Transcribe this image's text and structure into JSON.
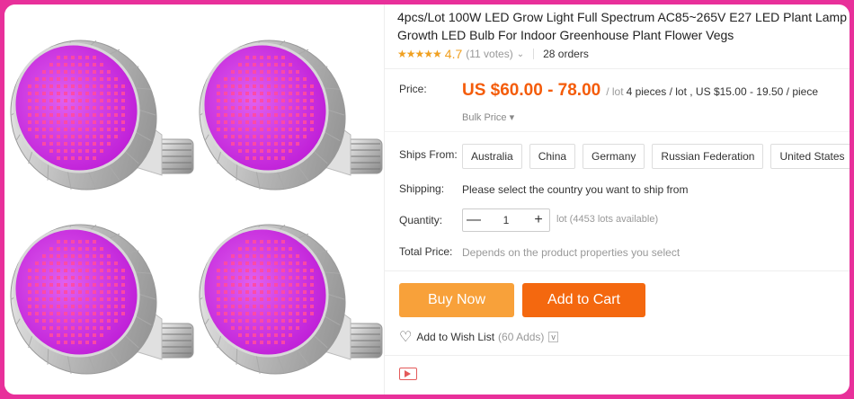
{
  "product": {
    "title_line1": "4pcs/Lot 100W LED Grow Light Full Spectrum AC85~265V E27 LED Plant Lamp",
    "title_line2": "Growth LED Bulb For Indoor Greenhouse Plant Flower Vegs",
    "stars": "★★★★★",
    "rating": "4.7",
    "votes": "(11 votes)",
    "orders": "28 orders"
  },
  "price": {
    "label": "Price:",
    "range": "US $60.00 - 78.00",
    "per": "/ lot",
    "bulk_info": "4 pieces / lot , US $15.00 - 19.50 / piece",
    "bulk_label": "Bulk Price ▾"
  },
  "ships_from": {
    "label": "Ships From:",
    "options": [
      "Australia",
      "China",
      "Germany",
      "Russian Federation",
      "United States"
    ]
  },
  "shipping": {
    "label": "Shipping:",
    "text": "Please select the country you want to ship from"
  },
  "quantity": {
    "label": "Quantity:",
    "value": "1",
    "minus": "—",
    "plus": "+",
    "available": "lot (4453 lots available)"
  },
  "total": {
    "label": "Total Price:",
    "text": "Depends on the product properties you select"
  },
  "actions": {
    "buy_now": "Buy Now",
    "add_to_cart": "Add to Cart",
    "wishlist": "Add to Wish List",
    "wishlist_count": "(60 Adds)",
    "wishlist_caret": "v"
  },
  "colors": {
    "accent": "#f45c0a",
    "buy_now": "#f8a13a",
    "add_to_cart": "#f4680f",
    "frame": "#e8309a",
    "lamp_face": "#c020d8"
  },
  "icons": {
    "heart": "heart-icon",
    "video": "video-icon",
    "star": "star-icon"
  }
}
